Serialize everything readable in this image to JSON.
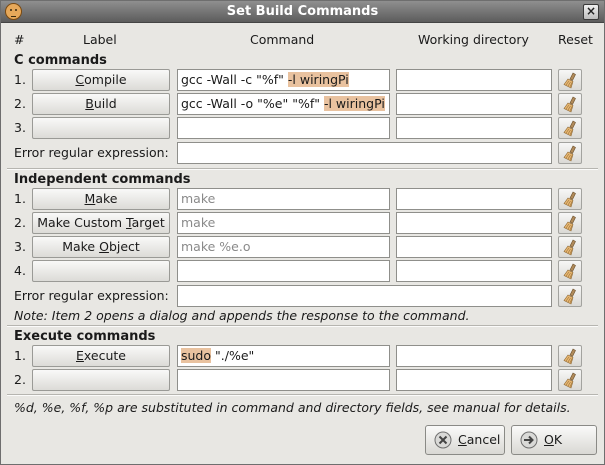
{
  "window": {
    "title": "Set Build Commands"
  },
  "headers": {
    "num": "#",
    "label": "Label",
    "command": "Command",
    "workdir": "Working directory",
    "reset": "Reset"
  },
  "c_commands": {
    "title": "C commands",
    "rows": [
      {
        "num": "1.",
        "label_pre": "",
        "label_mn": "C",
        "label_post": "ompile",
        "cmd_plain": "gcc -Wall -c \"%f\" ",
        "cmd_hl": "-l wiringPi",
        "workdir": ""
      },
      {
        "num": "2.",
        "label_pre": "",
        "label_mn": "B",
        "label_post": "uild",
        "cmd_plain": "gcc -Wall -o \"%e\" \"%f\" ",
        "cmd_hl": "-l wiringPi",
        "workdir": ""
      },
      {
        "num": "3.",
        "label_pre": "",
        "label_mn": "",
        "label_post": "",
        "cmd_plain": "",
        "cmd_hl": "",
        "workdir": ""
      }
    ],
    "error_label": "Error regular expression:",
    "error_value": ""
  },
  "independent_commands": {
    "title": "Independent commands",
    "rows": [
      {
        "num": "1.",
        "label_pre": "",
        "label_mn": "M",
        "label_post": "ake",
        "cmd": "make",
        "workdir": ""
      },
      {
        "num": "2.",
        "label_pre": "Make Custom ",
        "label_mn": "T",
        "label_post": "arget",
        "cmd": "make",
        "workdir": ""
      },
      {
        "num": "3.",
        "label_pre": "Make ",
        "label_mn": "O",
        "label_post": "bject",
        "cmd": "make %e.o",
        "workdir": ""
      },
      {
        "num": "4.",
        "label_pre": "",
        "label_mn": "",
        "label_post": "",
        "cmd": "",
        "workdir": ""
      }
    ],
    "error_label": "Error regular expression:",
    "error_value": "",
    "note": "Note: Item 2 opens a dialog and appends the response to the command."
  },
  "execute_commands": {
    "title": "Execute commands",
    "rows": [
      {
        "num": "1.",
        "label_pre": "",
        "label_mn": "E",
        "label_post": "xecute",
        "cmd_hl": "sudo",
        "cmd_plain": " \"./%e\"",
        "workdir": ""
      },
      {
        "num": "2.",
        "label_pre": "",
        "label_mn": "",
        "label_post": "",
        "cmd_hl": "",
        "cmd_plain": "",
        "workdir": ""
      }
    ]
  },
  "footer_note": "%d, %e, %f, %p are substituted in command and directory fields, see manual for details.",
  "buttons": {
    "cancel_mn": "C",
    "cancel_rest": "ancel",
    "ok_mn": "O",
    "ok_rest": "K"
  },
  "colors": {
    "highlight": "#e9c29f",
    "titlebar": "#6f6f6f"
  }
}
